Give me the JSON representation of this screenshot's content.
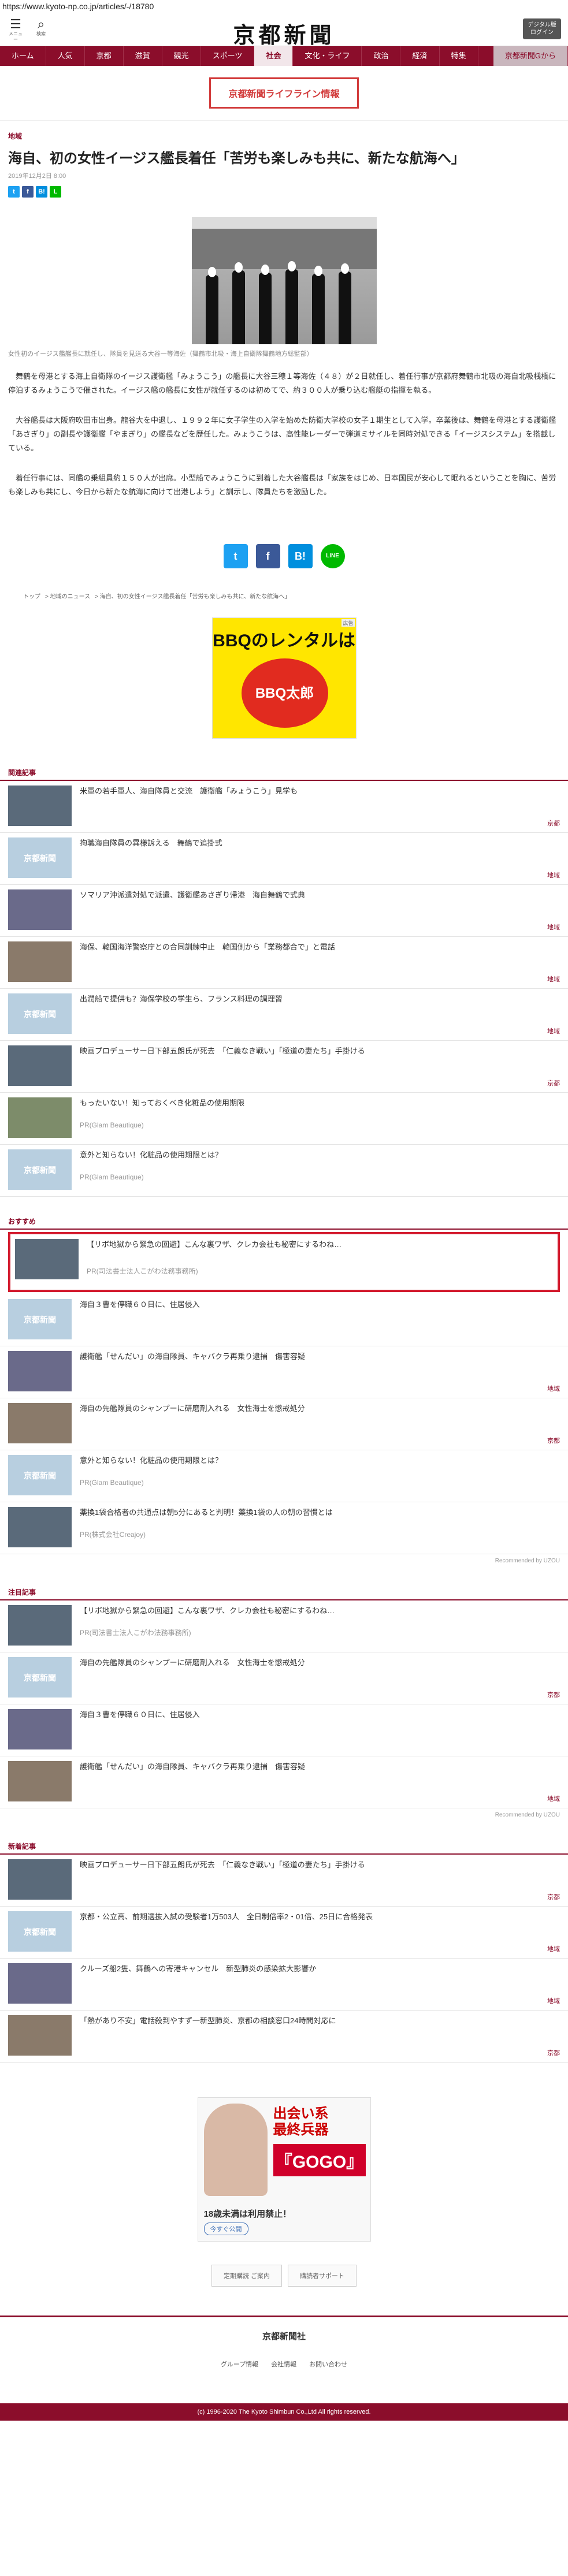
{
  "url": "https://www.kyoto-np.co.jp/articles/-/18780",
  "header": {
    "menu_label": "メニュー",
    "search_label": "検索",
    "logo_text": "京都新聞",
    "digital_btn": "デジタル版\nログイン"
  },
  "nav": [
    "ホーム",
    "人気",
    "京都",
    "滋賀",
    "観光",
    "スポーツ",
    "社会",
    "文化・ライフ",
    "政治",
    "経済",
    "特集",
    "京都新聞Gから"
  ],
  "nav_active": "社会",
  "lifeline": "京都新聞ライフライン情報",
  "article": {
    "section": "地域",
    "title": "海自、初の女性イージス艦長着任「苦労も楽しみも共に、新たな航海へ」",
    "date": "2019年12月2日 8:00",
    "caption": "女性初のイージス艦艦長に就任し、隊員を見送る大谷一等海佐（舞鶴市北吸・海上自衛隊舞鶴地方総監部）",
    "paragraphs": [
      "舞鶴を母港とする海上自衛隊のイージス護衛艦「みょうこう」の艦長に大谷三穂１等海佐（４８）が２日就任し、着任行事が京都府舞鶴市北吸の海自北吸桟橋に停泊するみょうこうで催された。イージス艦の艦長に女性が就任するのは初めてで、約３００人が乗り込む艦艇の指揮を執る。",
      "大谷艦長は大阪府吹田市出身。龍谷大を中退し、１９９２年に女子学生の入学を始めた防衛大学校の女子１期生として入学。卒業後は、舞鶴を母港とする護衛艦「あさぎり」の副長や護衛艦「やまぎり」の艦長などを歴任した。みょうこうは、高性能レーダーで弾道ミサイルを同時対処できる「イージスシステム」を搭載している。",
      "着任行事には、同艦の乗組員約１５０人が出席。小型船でみょうこうに到着した大谷艦長は「家族をはじめ、日本国民が安心して眠れるということを胸に、苦労も楽しみも共にし、今日から新たな航海に向けて出港しよう」と訓示し、隊員たちを激励した。"
    ]
  },
  "share": {
    "twitter": "t",
    "facebook": "f",
    "hatena": "B!",
    "line": "LINE"
  },
  "breadcrumbs": [
    "トップ",
    "地域のニュース",
    "海自、初の女性イージス艦長着任「苦労も楽しみも共に、新たな航海へ」"
  ],
  "ad_bbq": {
    "tag": "広告",
    "headline": "BBQのレンタルは",
    "brand": "BBQ太郎"
  },
  "related": {
    "title": "関連記事",
    "items": [
      {
        "text": "米軍の若手軍人、海自隊員と交流　護衛艦「みょうこう」見学も",
        "tag": "京都"
      },
      {
        "text": "拘職海自隊員の異様訴える　舞鶴で追掛式",
        "tag": "地域"
      },
      {
        "text": "ソマリア沖派遣対処で派遣、護衛艦あさぎり帰港　海自舞鶴で式典",
        "tag": "地域"
      },
      {
        "text": "海保、韓国海洋警察庁との合同訓練中止　韓国側から「業務都合で」と電話",
        "tag": "地域"
      },
      {
        "text": "出潤船で提供も？海保学校の学生ら、フランス料理の調理習",
        "tag": "地域"
      },
      {
        "text": "映画プロデューサー日下部五朗氏が死去　「仁義なき戦い」「極道の妻たち」手掛ける",
        "tag": "京都"
      },
      {
        "text": "もったいない！知っておくべき化粧品の使用期限",
        "src": "PR(Glam Beautique)"
      },
      {
        "text": "意外と知らない！化粧品の使用期限とは？",
        "src": "PR(Glam Beautique)"
      }
    ]
  },
  "recommend": {
    "title": "おすすめ",
    "items": [
      {
        "text": "【リボ地獄から緊急の回避】こんな裏ワザ、クレカ会社も秘密にするわね…",
        "src": "PR(司法書士法人こがわ法務事務所)"
      },
      {
        "text": "海自３曹を停職６０日に、住居侵入",
        "tag": ""
      },
      {
        "text": "護衛艦「せんだい」の海自隊員、キャバクラ再乗り逮捕　傷害容疑",
        "tag": "地域"
      },
      {
        "text": "海自の先艦隊員のシャンプーに研磨剤入れる　女性海士を懲戒処分",
        "tag": "京都"
      },
      {
        "text": "意外と知らない！化粧品の使用期限とは？",
        "src": "PR(Glam Beautique)"
      },
      {
        "text": "薬換1袋合格者の共通点は朝5分にあると判明！薬換1袋の人の朝の習慣とは",
        "src": "PR(株式会社Creajoy)"
      }
    ],
    "powered": "Recommended by UZOU"
  },
  "popular": {
    "title": "注目記事",
    "items": [
      {
        "text": "【リボ地獄から緊急の回避】こんな裏ワザ、クレカ会社も秘密にするわね…",
        "src": "PR(司法書士法人こがわ法務事務所)"
      },
      {
        "text": "海自の先艦隊員のシャンプーに研磨剤入れる　女性海士を懲戒処分",
        "tag": "京都"
      },
      {
        "text": "海自３曹を停職６０日に、住居侵入",
        "tag": ""
      },
      {
        "text": "護衛艦「せんだい」の海自隊員、キャバクラ再乗り逮捕　傷害容疑",
        "tag": "地域"
      }
    ],
    "powered": "Recommended by UZOU"
  },
  "latest": {
    "title": "新着記事",
    "items": [
      {
        "text": "映画プロデューサー日下部五朗氏が死去　「仁義なき戦い」「極道の妻たち」手掛ける",
        "tag": "京都"
      },
      {
        "text": "京都・公立高、前期選抜入試の受験者1万503人　全日制倍率2・01倍、25日に合格発表",
        "tag": "地域"
      },
      {
        "text": "クルーズ船2隻、舞鶴への寄港キャンセル　新型肺炎の感染拡大影響か",
        "tag": "地域"
      },
      {
        "text": "「熱があり不安」電話殺到やすず一新型肺炎、京都の相談窓口24時間対応に",
        "tag": "京都"
      }
    ]
  },
  "ad_gogo": {
    "line1": "出会い系",
    "line2": "最終兵器",
    "brand": "『GOGO』",
    "line3": "18歳未満は利用禁止！",
    "btn": "今すぐ公開"
  },
  "footer": {
    "btn1": "定期購読 ご案内",
    "btn2": "購読者サポート",
    "logo": "京都新聞社",
    "links": [
      "グループ情報",
      "会社情報",
      "お問い合わせ"
    ],
    "copyright": "(c) 1996-2020 The Kyoto Shimbun Co.,Ltd All rights reserved."
  }
}
